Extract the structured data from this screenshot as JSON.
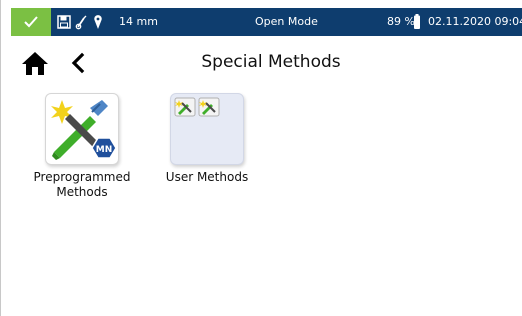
{
  "status_bar": {
    "check_icon": "check-icon",
    "save_icon": "floppy-disk-icon",
    "probe_icon": "probe-icon",
    "location_icon": "location-pin-icon",
    "depth": "14 mm",
    "mode": "Open Mode",
    "battery": "89 %",
    "battery_icon": "battery-icon",
    "datetime": "02.11.2020 09:04",
    "colors": {
      "background": "#0e3d6e",
      "check_background": "#7bc043",
      "text": "#ffffff"
    }
  },
  "header": {
    "home_icon": "home-icon",
    "back_icon": "chevron-left-icon",
    "title": "Special Methods"
  },
  "tiles": [
    {
      "label": "Preprogrammed\nMethods",
      "icon": "preprogrammed-methods-icon",
      "logo_text": "MN"
    },
    {
      "label": "User Methods",
      "icon": "user-methods-icon"
    }
  ]
}
